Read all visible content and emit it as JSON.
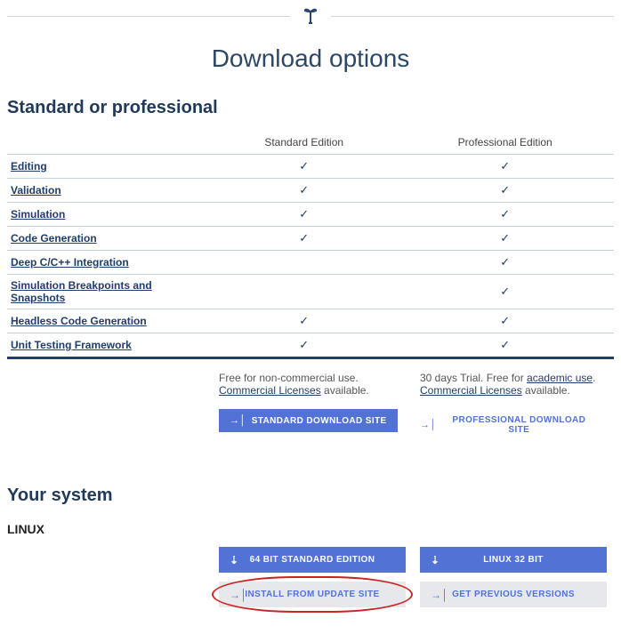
{
  "page": {
    "title": "Download options",
    "section_compare": "Standard or professional",
    "section_system": "Your system"
  },
  "table": {
    "col_std": "Standard Edition",
    "col_pro": "Professional Edition",
    "rows": [
      {
        "label": "Editing",
        "std": true,
        "pro": true
      },
      {
        "label": "Validation",
        "std": true,
        "pro": true
      },
      {
        "label": "Simulation",
        "std": true,
        "pro": true
      },
      {
        "label": "Code Generation",
        "std": true,
        "pro": true
      },
      {
        "label": "Deep C/C++ Integration",
        "std": false,
        "pro": true
      },
      {
        "label": "Simulation Breakpoints and Snapshots",
        "std": false,
        "pro": true
      },
      {
        "label": "Headless Code Generation",
        "std": true,
        "pro": true
      },
      {
        "label": "Unit Testing Framework",
        "std": true,
        "pro": true
      }
    ]
  },
  "std_note": {
    "prefix": "Free for non-commercial use. ",
    "link": "Commercial Licenses",
    "suffix": " available."
  },
  "pro_note": {
    "prefix": "30 days Trial. Free for ",
    "link1": "academic use",
    "mid": ". ",
    "link2": "Commercial Licenses",
    "suffix": " available."
  },
  "buttons": {
    "std_site": "Standard Download Site",
    "pro_site": "Professional Download Site"
  },
  "system": {
    "os": "LINUX",
    "b64": "64 Bit Standard Edition",
    "b32": "Linux 32 Bit",
    "update": "Install From Update Site",
    "prev": "Get Previous Versions"
  }
}
